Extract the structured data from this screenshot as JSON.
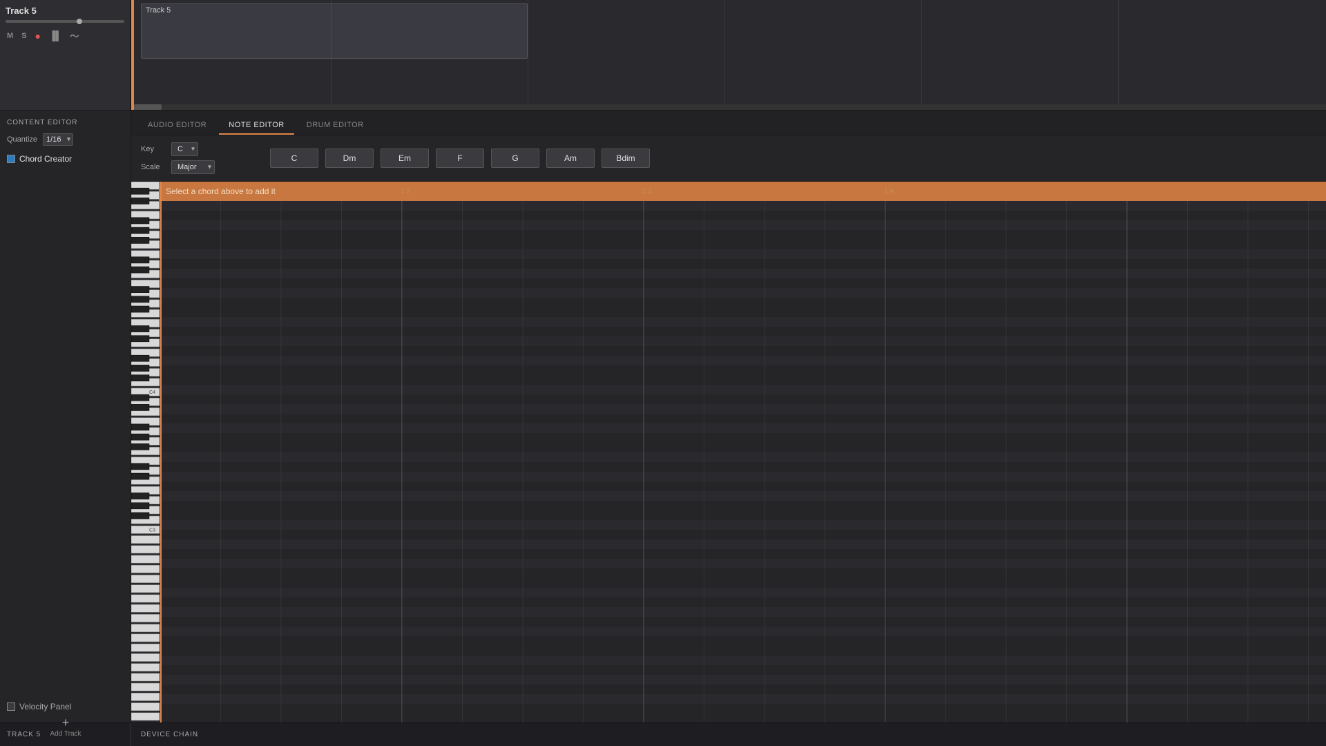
{
  "track": {
    "name": "Track 5",
    "clip_label": "Track 5"
  },
  "add_track": {
    "plus": "+",
    "label": "Add Track"
  },
  "content_editor": {
    "title": "CONTENT EDITOR",
    "quantize_label": "Quantize",
    "quantize_value": "1/16",
    "chord_creator_label": "Chord Creator",
    "velocity_panel_label": "Velocity Panel"
  },
  "editor_tabs": [
    {
      "id": "audio",
      "label": "AUDIO EDITOR",
      "active": false
    },
    {
      "id": "note",
      "label": "NOTE EDITOR",
      "active": true
    },
    {
      "id": "drum",
      "label": "DRUM EDITOR",
      "active": false
    }
  ],
  "note_editor": {
    "key_label": "Key",
    "key_value": "C",
    "scale_label": "Scale",
    "scale_value": "Major",
    "chord_hint": "Select a chord above to add it",
    "piano_labels": [
      "C4",
      "C3"
    ],
    "measure_markers": [
      "1:2",
      "1:3",
      "1:4"
    ]
  },
  "chords": [
    {
      "label": "C"
    },
    {
      "label": "Dm"
    },
    {
      "label": "Em"
    },
    {
      "label": "F"
    },
    {
      "label": "G"
    },
    {
      "label": "Am"
    },
    {
      "label": "Bdim"
    }
  ],
  "bottom_bar": {
    "track_label": "TRACK 5",
    "device_label": "DEVICE CHAIN"
  },
  "track_controls": {
    "mute": "M",
    "solo": "S",
    "record": "●",
    "bars": "▐▐",
    "wave": "〜"
  }
}
